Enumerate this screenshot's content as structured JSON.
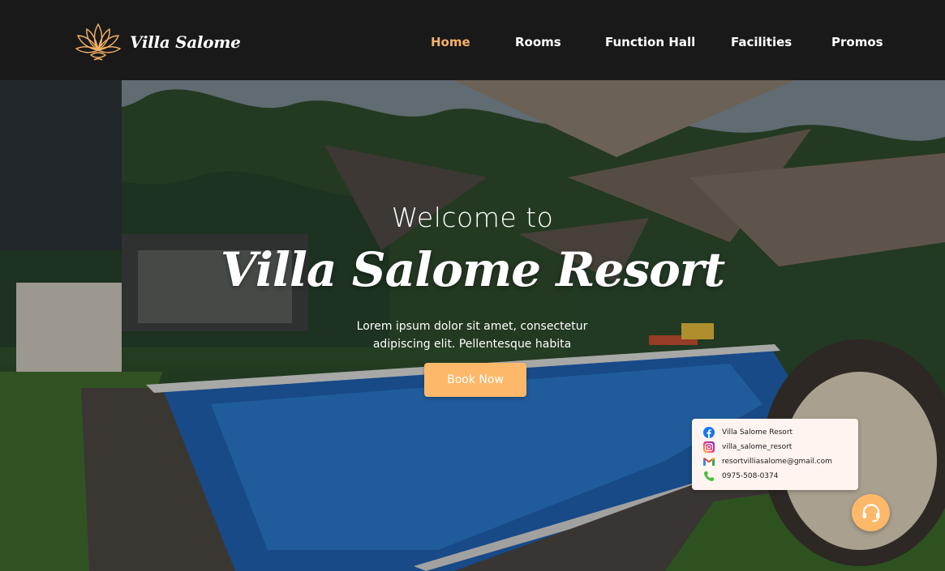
{
  "brand": {
    "name": "Villa Salome",
    "logo_icon": "lotus-icon",
    "accent_color": "#f5b267"
  },
  "nav": {
    "items": [
      {
        "label": "Home",
        "active": true
      },
      {
        "label": "Rooms",
        "active": false
      },
      {
        "label": "Function Hall",
        "active": false
      },
      {
        "label": "Facilities",
        "active": false
      },
      {
        "label": "Promos",
        "active": false
      }
    ]
  },
  "hero": {
    "welcome": "Welcome to",
    "title": "Villa Salome Resort",
    "description": "Lorem ipsum dolor sit amet, consectetur adipiscing elit. Pellentesque habita",
    "button_label": "Book Now",
    "button_color": "#fdb86a"
  },
  "contact": {
    "facebook": {
      "icon": "facebook-icon",
      "text": "Villa Salome Resort"
    },
    "instagram": {
      "icon": "instagram-icon",
      "text": "villa_salome_resort"
    },
    "email": {
      "icon": "gmail-icon",
      "text": "resortvilliasalome@gmail.com"
    },
    "phone": {
      "icon": "phone-icon",
      "text": "0975-508-0374"
    }
  },
  "support": {
    "icon": "headset-icon"
  }
}
